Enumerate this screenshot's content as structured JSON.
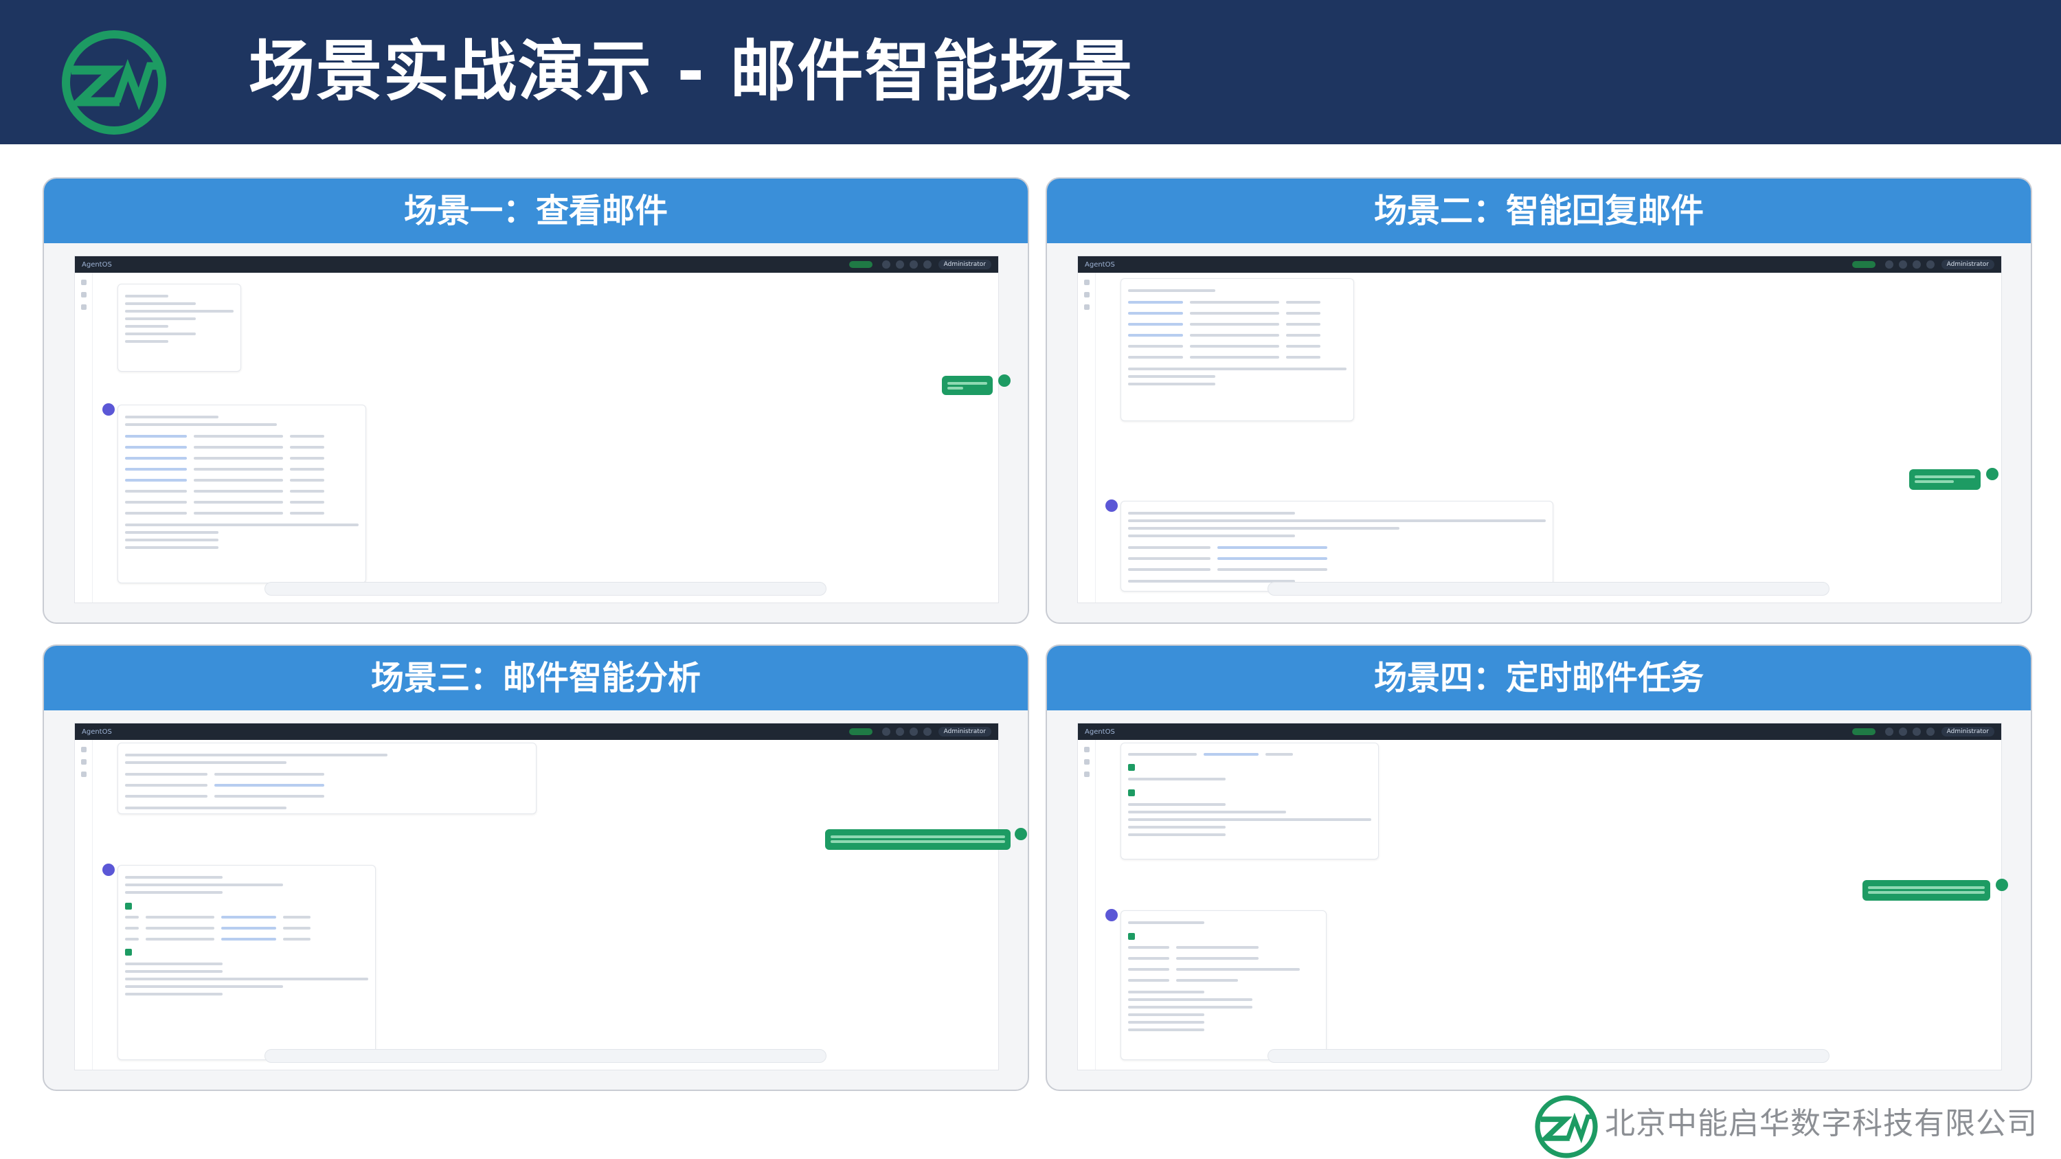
{
  "header": {
    "title": "场景实战演示 - 邮件智能场景"
  },
  "panels": [
    {
      "label": "场景一：查看邮件"
    },
    {
      "label": "场景二：智能回复邮件"
    },
    {
      "label": "场景三：邮件智能分析"
    },
    {
      "label": "场景四：定时邮件任务"
    }
  ],
  "app": {
    "brand": "AgentOS",
    "user": "Administrator"
  },
  "footer": {
    "company": "北京中能启华数字科技有限公司"
  },
  "colors": {
    "header_bg": "#1e3560",
    "panel_header": "#3a8fd9",
    "logo_green": "#1d9b63"
  }
}
